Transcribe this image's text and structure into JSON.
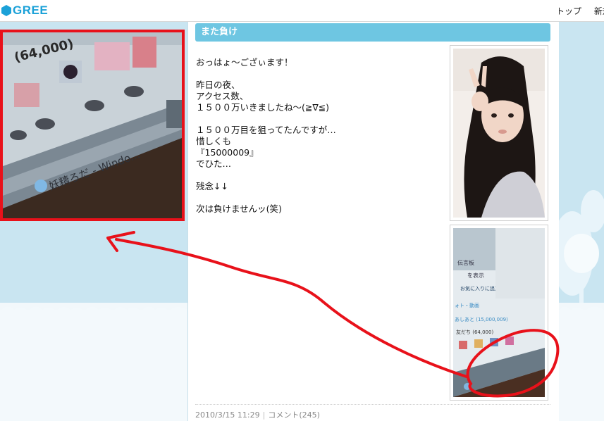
{
  "header": {
    "logo_text": "GREE",
    "nav": [
      "トップ",
      "新規"
    ]
  },
  "entry": {
    "title": "また負け",
    "body_lines": [
      "おっはょ〜ござぃます！",
      "",
      "昨日の夜、",
      "アクセス数、",
      "１５００万いきましたね〜(≧∇≦)",
      "",
      "１５００万目を狙ってたんですが…",
      "惜しくも",
      "『15000009』",
      "でひた…",
      "",
      "残念↓↓",
      "",
      "次は負けませんッ(笑)"
    ],
    "date": "2010/3/15 11:29",
    "comments": "コメント(245)"
  },
  "zoom_crop": {
    "count_text": "(64,000)",
    "window_text": "妖精ろだ - Windo..."
  },
  "screen_photo": {
    "lines": [
      "伝言板",
      "を表示",
      "お気に入りに追加",
      "ォト・動画",
      "あしあと (15,000,009)",
      "友だち (64,000)"
    ]
  },
  "colors": {
    "accent": "#6ec6e2",
    "logo": "#1ba1d8",
    "annotation": "#e8111a"
  }
}
